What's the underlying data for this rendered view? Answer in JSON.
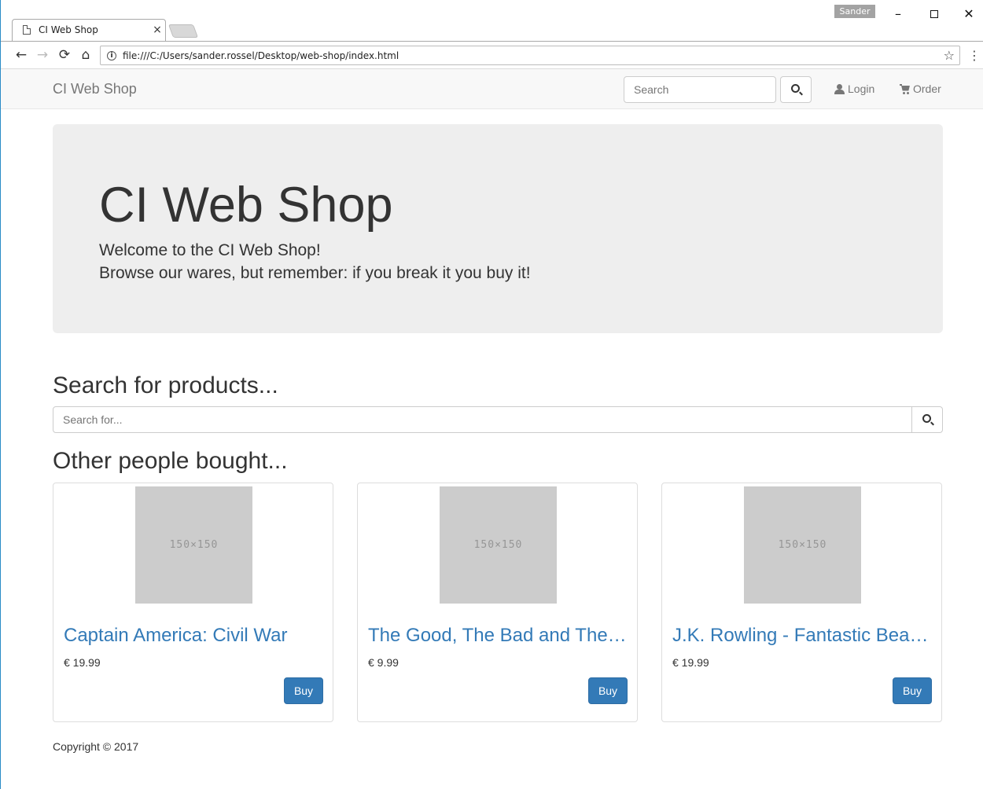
{
  "browser": {
    "tab_title": "CI Web Shop",
    "tab_close": "×",
    "user_badge": "Sander",
    "url": "file:///C:/Users/sander.rossel/Desktop/web-shop/index.html",
    "icons": [
      "doc-icon",
      "back-icon",
      "forward-icon",
      "reload-icon",
      "home-icon",
      "info-icon",
      "star-icon",
      "menu-icon"
    ]
  },
  "navbar": {
    "brand": "CI Web Shop",
    "search_placeholder": "Search",
    "login_label": "Login",
    "order_label": "Order"
  },
  "jumbotron": {
    "title": "CI Web Shop",
    "line1": "Welcome to the CI Web Shop!",
    "line2": "Browse our wares, but remember: if you break it you buy it!"
  },
  "search": {
    "heading": "Search for products...",
    "placeholder": "Search for..."
  },
  "products": {
    "heading": "Other people bought...",
    "items": [
      {
        "thumb": "150×150",
        "title": "Captain America: Civil War",
        "price": "€ 19.99",
        "buy_label": "Buy"
      },
      {
        "thumb": "150×150",
        "title": "The Good, The Bad and The Ugly",
        "price": "€ 9.99",
        "buy_label": "Buy"
      },
      {
        "thumb": "150×150",
        "title": "J.K. Rowling - Fantastic Beasts and Where to Find Them",
        "price": "€ 19.99",
        "buy_label": "Buy"
      }
    ]
  },
  "footer": {
    "copyright": "Copyright © 2017"
  },
  "colors": {
    "link": "#337ab7",
    "button_primary": "#337ab7",
    "jumbotron_bg": "#eeeeee",
    "navbar_bg": "#f8f8f8",
    "placeholder_bg": "#cccccc"
  }
}
